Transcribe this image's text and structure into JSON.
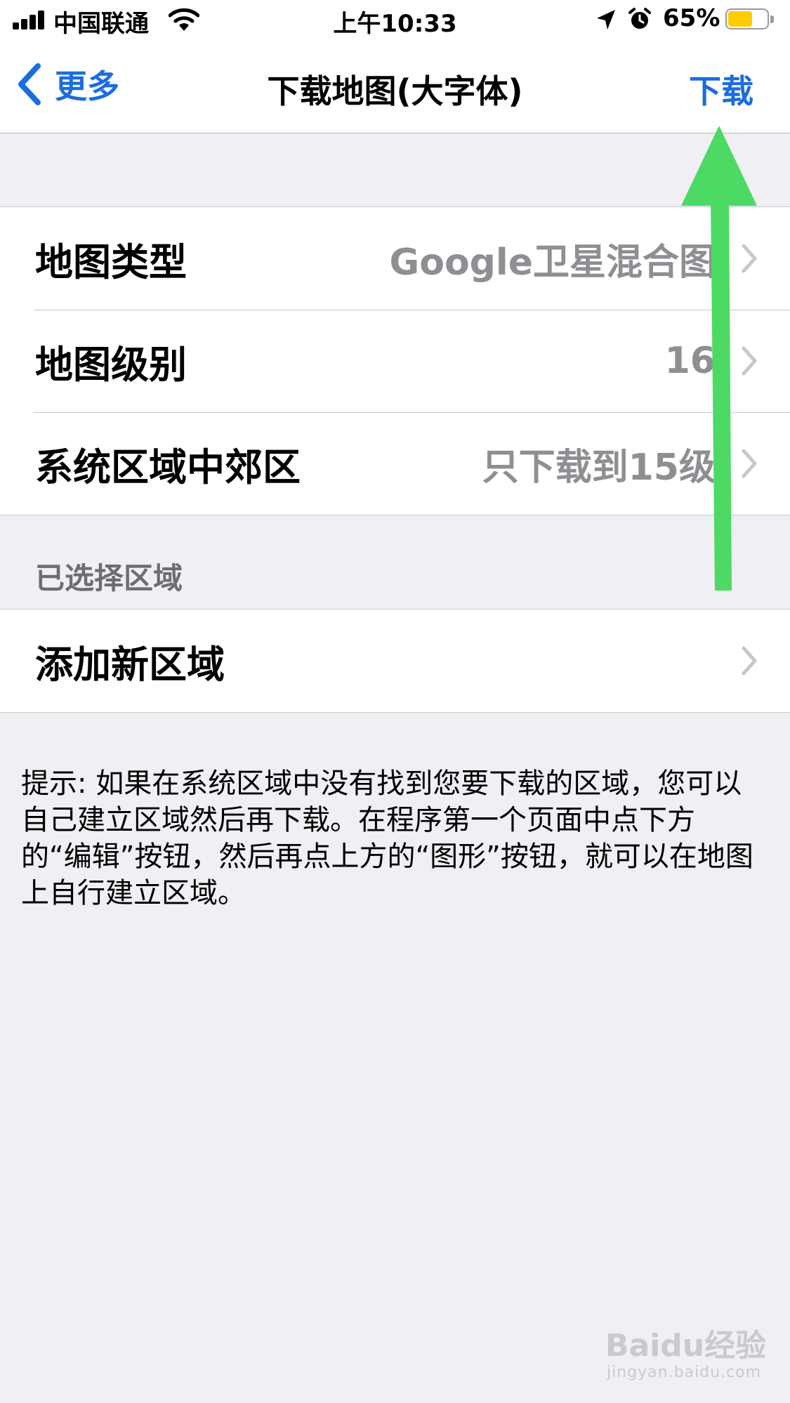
{
  "status_bar": {
    "carrier": "中国联通",
    "time": "上午10:33",
    "battery_percent": "65%",
    "battery_level": 0.65
  },
  "nav": {
    "back_label": "更多",
    "title": "下载地图(大字体)",
    "action_label": "下载"
  },
  "settings": [
    {
      "label": "地图类型",
      "value": "Google卫星混合图"
    },
    {
      "label": "地图级别",
      "value": "16"
    },
    {
      "label": "系统区域中郊区",
      "value": "只下载到15级"
    }
  ],
  "selected_section": {
    "header": "已选择区域",
    "rows": [
      {
        "label": "添加新区域",
        "value": ""
      }
    ]
  },
  "footer_note": "提示: 如果在系统区域中没有找到您要下载的区域，您可以自己建立区域然后再下载。在程序第一个页面中点下方的“编辑”按钮，然后再点上方的“图形”按钮，就可以在地图上自行建立区域。",
  "watermark": {
    "logo": "Baidu经验",
    "url": "jingyan.baidu.com"
  },
  "colors": {
    "accent_blue": "#1a6de0",
    "annotation_green": "#4cd964",
    "battery_yellow": "#ffcc00",
    "secondary_text": "#8e8e93",
    "grouped_background": "#efeff4"
  }
}
